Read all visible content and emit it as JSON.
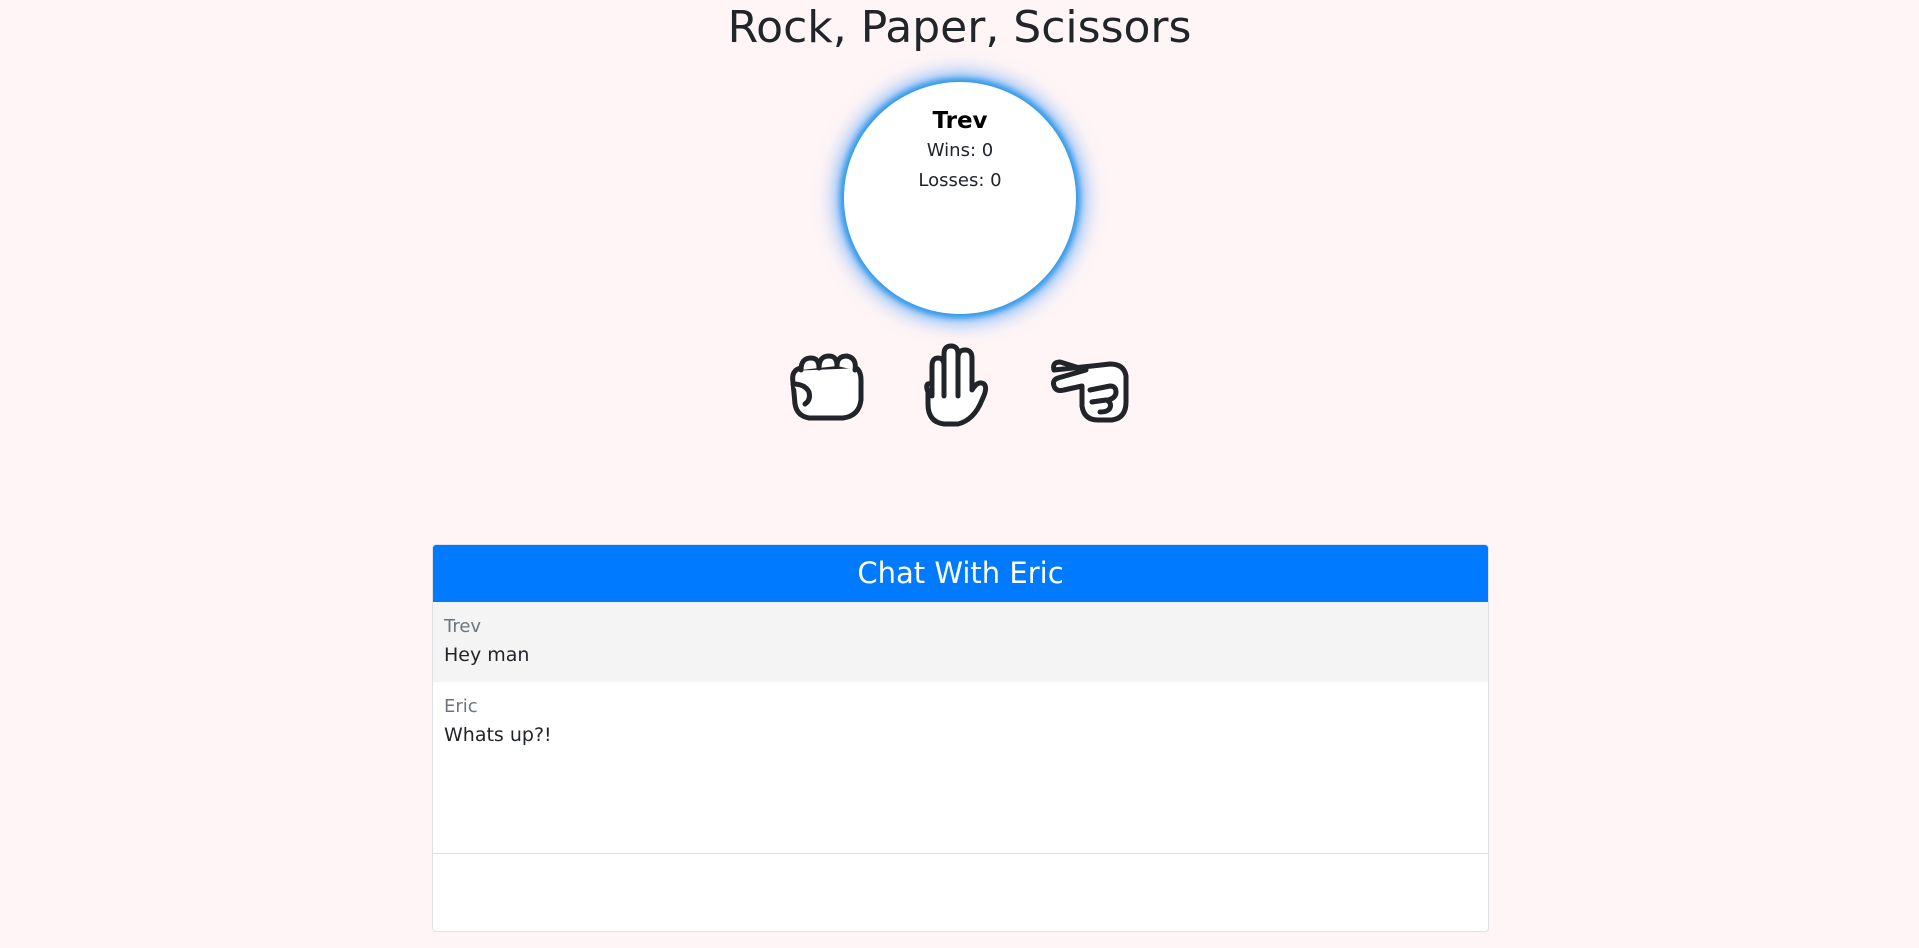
{
  "page": {
    "title": "Rock, Paper, Scissors"
  },
  "player": {
    "name": "Trev",
    "wins": "Wins: 0",
    "losses": "Losses: 0"
  },
  "choices": [
    {
      "name": "rock",
      "icon": "fist-icon"
    },
    {
      "name": "paper",
      "icon": "open-hand-icon"
    },
    {
      "name": "scissors",
      "icon": "peace-hand-icon"
    }
  ],
  "chat": {
    "header": "Chat With Eric",
    "messages": [
      {
        "author": "Trev",
        "text": "Hey man"
      },
      {
        "author": "Eric",
        "text": "Whats up?!"
      }
    ],
    "input_placeholder": ""
  },
  "colors": {
    "accent": "#007bff",
    "background": "#fff5f6",
    "glow": "#3399e6"
  }
}
